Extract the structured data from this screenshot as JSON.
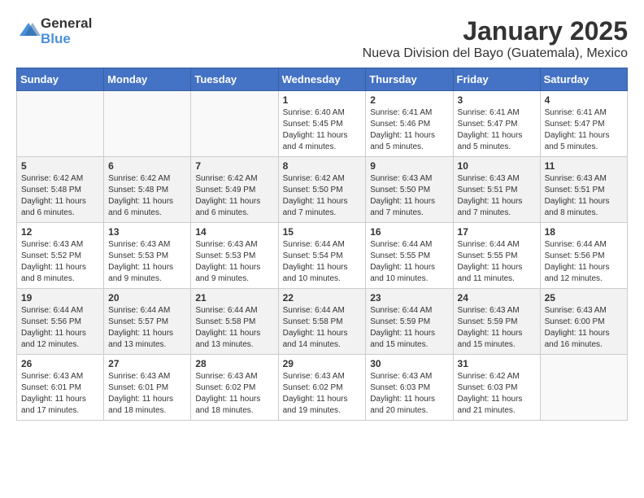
{
  "header": {
    "logo_general": "General",
    "logo_blue": "Blue",
    "title": "January 2025",
    "subtitle": "Nueva Division del Bayo (Guatemala), Mexico"
  },
  "days_of_week": [
    "Sunday",
    "Monday",
    "Tuesday",
    "Wednesday",
    "Thursday",
    "Friday",
    "Saturday"
  ],
  "weeks": [
    [
      {
        "day": "",
        "info": ""
      },
      {
        "day": "",
        "info": ""
      },
      {
        "day": "",
        "info": ""
      },
      {
        "day": "1",
        "info": "Sunrise: 6:40 AM\nSunset: 5:45 PM\nDaylight: 11 hours and 4 minutes."
      },
      {
        "day": "2",
        "info": "Sunrise: 6:41 AM\nSunset: 5:46 PM\nDaylight: 11 hours and 5 minutes."
      },
      {
        "day": "3",
        "info": "Sunrise: 6:41 AM\nSunset: 5:47 PM\nDaylight: 11 hours and 5 minutes."
      },
      {
        "day": "4",
        "info": "Sunrise: 6:41 AM\nSunset: 5:47 PM\nDaylight: 11 hours and 5 minutes."
      }
    ],
    [
      {
        "day": "5",
        "info": "Sunrise: 6:42 AM\nSunset: 5:48 PM\nDaylight: 11 hours and 6 minutes."
      },
      {
        "day": "6",
        "info": "Sunrise: 6:42 AM\nSunset: 5:48 PM\nDaylight: 11 hours and 6 minutes."
      },
      {
        "day": "7",
        "info": "Sunrise: 6:42 AM\nSunset: 5:49 PM\nDaylight: 11 hours and 6 minutes."
      },
      {
        "day": "8",
        "info": "Sunrise: 6:42 AM\nSunset: 5:50 PM\nDaylight: 11 hours and 7 minutes."
      },
      {
        "day": "9",
        "info": "Sunrise: 6:43 AM\nSunset: 5:50 PM\nDaylight: 11 hours and 7 minutes."
      },
      {
        "day": "10",
        "info": "Sunrise: 6:43 AM\nSunset: 5:51 PM\nDaylight: 11 hours and 7 minutes."
      },
      {
        "day": "11",
        "info": "Sunrise: 6:43 AM\nSunset: 5:51 PM\nDaylight: 11 hours and 8 minutes."
      }
    ],
    [
      {
        "day": "12",
        "info": "Sunrise: 6:43 AM\nSunset: 5:52 PM\nDaylight: 11 hours and 8 minutes."
      },
      {
        "day": "13",
        "info": "Sunrise: 6:43 AM\nSunset: 5:53 PM\nDaylight: 11 hours and 9 minutes."
      },
      {
        "day": "14",
        "info": "Sunrise: 6:43 AM\nSunset: 5:53 PM\nDaylight: 11 hours and 9 minutes."
      },
      {
        "day": "15",
        "info": "Sunrise: 6:44 AM\nSunset: 5:54 PM\nDaylight: 11 hours and 10 minutes."
      },
      {
        "day": "16",
        "info": "Sunrise: 6:44 AM\nSunset: 5:55 PM\nDaylight: 11 hours and 10 minutes."
      },
      {
        "day": "17",
        "info": "Sunrise: 6:44 AM\nSunset: 5:55 PM\nDaylight: 11 hours and 11 minutes."
      },
      {
        "day": "18",
        "info": "Sunrise: 6:44 AM\nSunset: 5:56 PM\nDaylight: 11 hours and 12 minutes."
      }
    ],
    [
      {
        "day": "19",
        "info": "Sunrise: 6:44 AM\nSunset: 5:56 PM\nDaylight: 11 hours and 12 minutes."
      },
      {
        "day": "20",
        "info": "Sunrise: 6:44 AM\nSunset: 5:57 PM\nDaylight: 11 hours and 13 minutes."
      },
      {
        "day": "21",
        "info": "Sunrise: 6:44 AM\nSunset: 5:58 PM\nDaylight: 11 hours and 13 minutes."
      },
      {
        "day": "22",
        "info": "Sunrise: 6:44 AM\nSunset: 5:58 PM\nDaylight: 11 hours and 14 minutes."
      },
      {
        "day": "23",
        "info": "Sunrise: 6:44 AM\nSunset: 5:59 PM\nDaylight: 11 hours and 15 minutes."
      },
      {
        "day": "24",
        "info": "Sunrise: 6:43 AM\nSunset: 5:59 PM\nDaylight: 11 hours and 15 minutes."
      },
      {
        "day": "25",
        "info": "Sunrise: 6:43 AM\nSunset: 6:00 PM\nDaylight: 11 hours and 16 minutes."
      }
    ],
    [
      {
        "day": "26",
        "info": "Sunrise: 6:43 AM\nSunset: 6:01 PM\nDaylight: 11 hours and 17 minutes."
      },
      {
        "day": "27",
        "info": "Sunrise: 6:43 AM\nSunset: 6:01 PM\nDaylight: 11 hours and 18 minutes."
      },
      {
        "day": "28",
        "info": "Sunrise: 6:43 AM\nSunset: 6:02 PM\nDaylight: 11 hours and 18 minutes."
      },
      {
        "day": "29",
        "info": "Sunrise: 6:43 AM\nSunset: 6:02 PM\nDaylight: 11 hours and 19 minutes."
      },
      {
        "day": "30",
        "info": "Sunrise: 6:43 AM\nSunset: 6:03 PM\nDaylight: 11 hours and 20 minutes."
      },
      {
        "day": "31",
        "info": "Sunrise: 6:42 AM\nSunset: 6:03 PM\nDaylight: 11 hours and 21 minutes."
      },
      {
        "day": "",
        "info": ""
      }
    ]
  ]
}
